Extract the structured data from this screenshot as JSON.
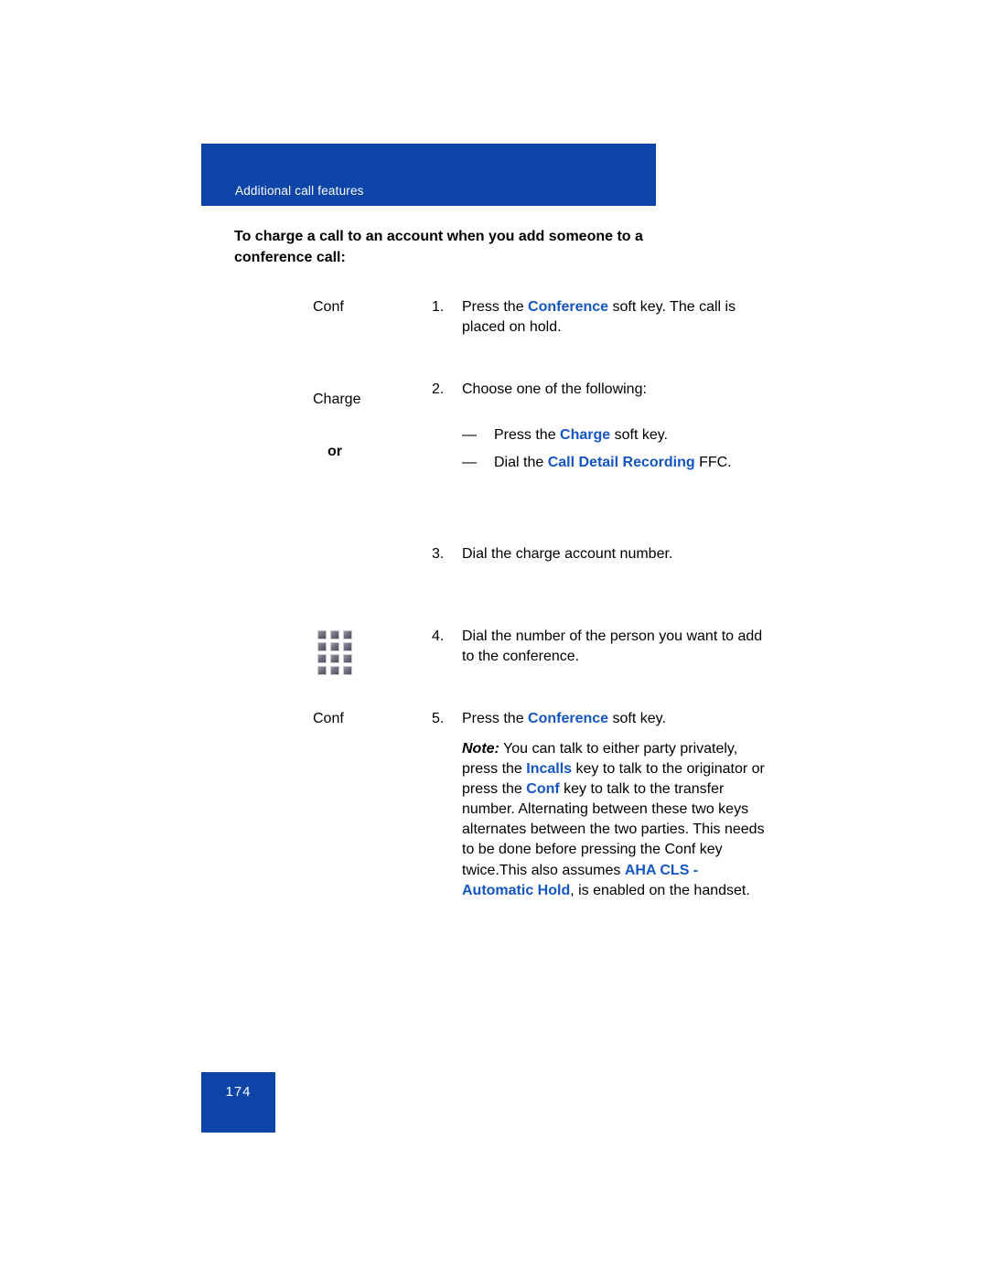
{
  "header": {
    "banner_title": "Additional call features",
    "banner_color": "#0c44a8"
  },
  "heading": "To charge a call to an account when you add someone to a conference call:",
  "accent_color": "#1455c0",
  "steps": [
    {
      "number": "1.",
      "label": "Conf",
      "icon": null,
      "text_parts": [
        {
          "text": "Press the ",
          "style": "plain"
        },
        {
          "text": "Conference",
          "style": "keyword"
        },
        {
          "text": " soft key. The call is placed on hold.",
          "style": "plain"
        }
      ]
    },
    {
      "number": "2.",
      "label": "Charge",
      "label_or": "or",
      "icon": null,
      "text_parts": [
        {
          "text": "Choose one of the following:",
          "style": "plain"
        }
      ],
      "sub_items": [
        {
          "dash": "—",
          "parts": [
            {
              "text": "Press the ",
              "style": "plain"
            },
            {
              "text": "Charge",
              "style": "keyword"
            },
            {
              "text": " soft key.",
              "style": "plain"
            }
          ]
        },
        {
          "dash": "—",
          "parts": [
            {
              "text": "Dial the ",
              "style": "plain"
            },
            {
              "text": "Call Detail Recording",
              "style": "keyword"
            },
            {
              "text": " FFC.",
              "style": "plain"
            }
          ]
        }
      ]
    },
    {
      "number": "3.",
      "label": null,
      "icon": null,
      "text_parts": [
        {
          "text": "Dial the charge account number.",
          "style": "plain"
        }
      ]
    },
    {
      "number": "4.",
      "label": null,
      "icon": "dialpad-icon",
      "text_parts": [
        {
          "text": "Dial the number of the person you want to add to the conference.",
          "style": "plain"
        }
      ]
    },
    {
      "number": "5.",
      "label": "Conf",
      "icon": null,
      "text_parts": [
        {
          "text": "Press the ",
          "style": "plain"
        },
        {
          "text": "Conference",
          "style": "keyword"
        },
        {
          "text": " soft key.",
          "style": "plain"
        }
      ],
      "note_parts": [
        {
          "text": "Note:",
          "style": "note-lead"
        },
        {
          "text": " You can talk to either party privately, press the ",
          "style": "plain"
        },
        {
          "text": "Incalls",
          "style": "keyword"
        },
        {
          "text": " key to talk to the originator or press the ",
          "style": "plain"
        },
        {
          "text": "Conf",
          "style": "keyword"
        },
        {
          "text": " key to talk to the transfer number. Alternating between these two keys alternates between the two parties. This needs to be done before pressing the Conf key twice.This also assumes ",
          "style": "plain"
        },
        {
          "text": "AHA CLS - Automatic Hold",
          "style": "keyword"
        },
        {
          "text": ", is enabled on the handset.",
          "style": "plain"
        }
      ]
    }
  ],
  "footer": {
    "page_number": "174"
  }
}
